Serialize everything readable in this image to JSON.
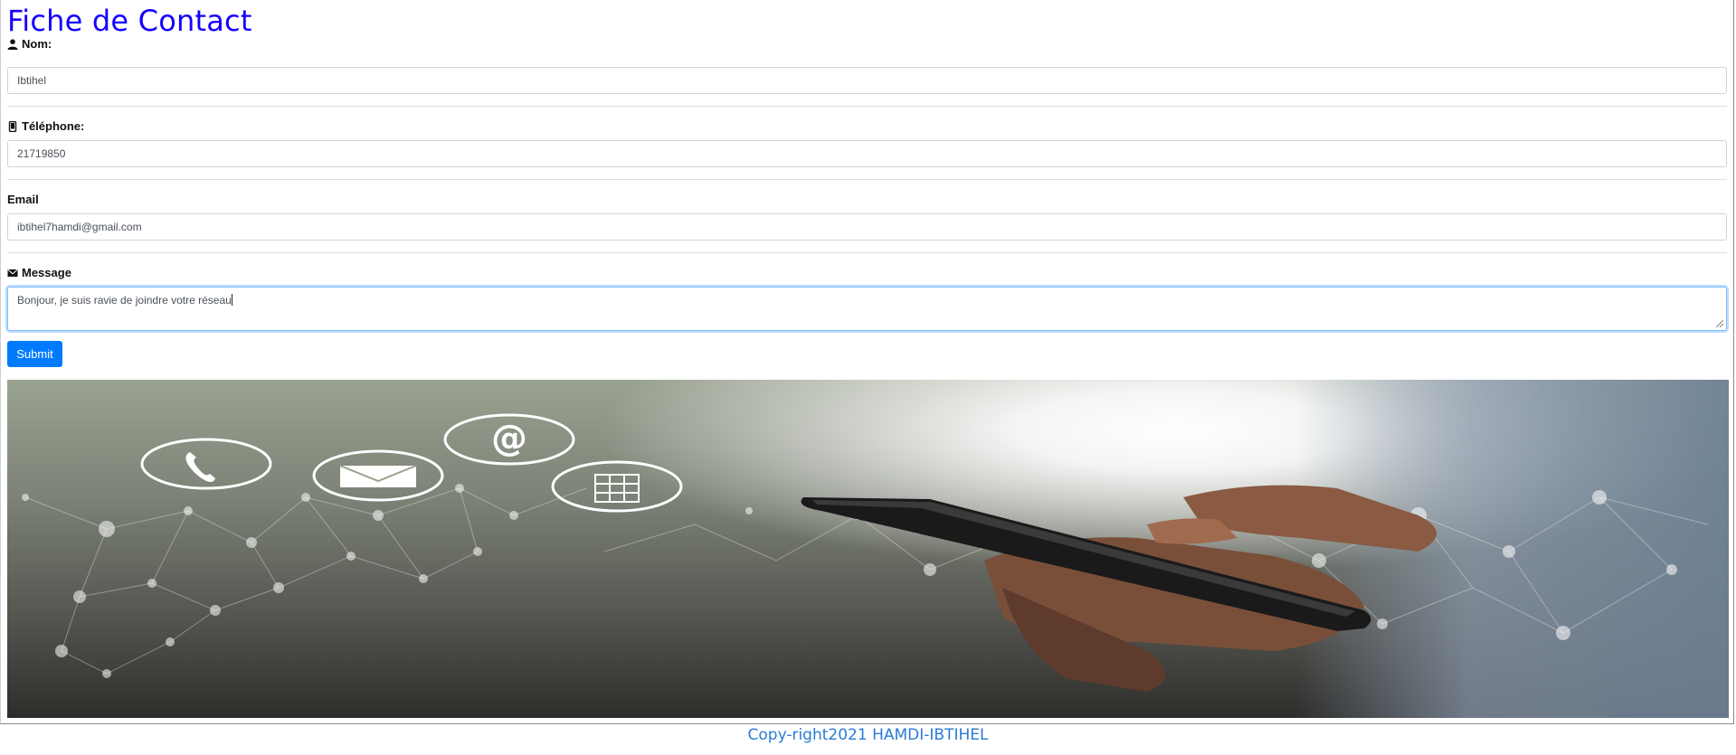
{
  "page": {
    "title": "Fiche de Contact",
    "accent_color": "#1400ff"
  },
  "form": {
    "nom": {
      "label": "Nom:",
      "icon": "user-icon",
      "value": "Ibtihel"
    },
    "telephone": {
      "label": "Téléphone:",
      "icon": "phone-icon",
      "value": "21719850"
    },
    "email": {
      "label": "Email",
      "value": "ibtihel7hamdi@gmail.com"
    },
    "message": {
      "label": "Message",
      "icon": "envelope-icon",
      "value": "Bonjour, je suis ravie de joindre votre réseau"
    },
    "submit_label": "Submit",
    "submit_color": "#007bff"
  },
  "hero": {
    "icons": [
      "phone-icon",
      "envelope-icon",
      "at-icon",
      "calendar-icon"
    ]
  },
  "footer": {
    "text": "Copy-right2021 HAMDI-IBTIHEL"
  }
}
